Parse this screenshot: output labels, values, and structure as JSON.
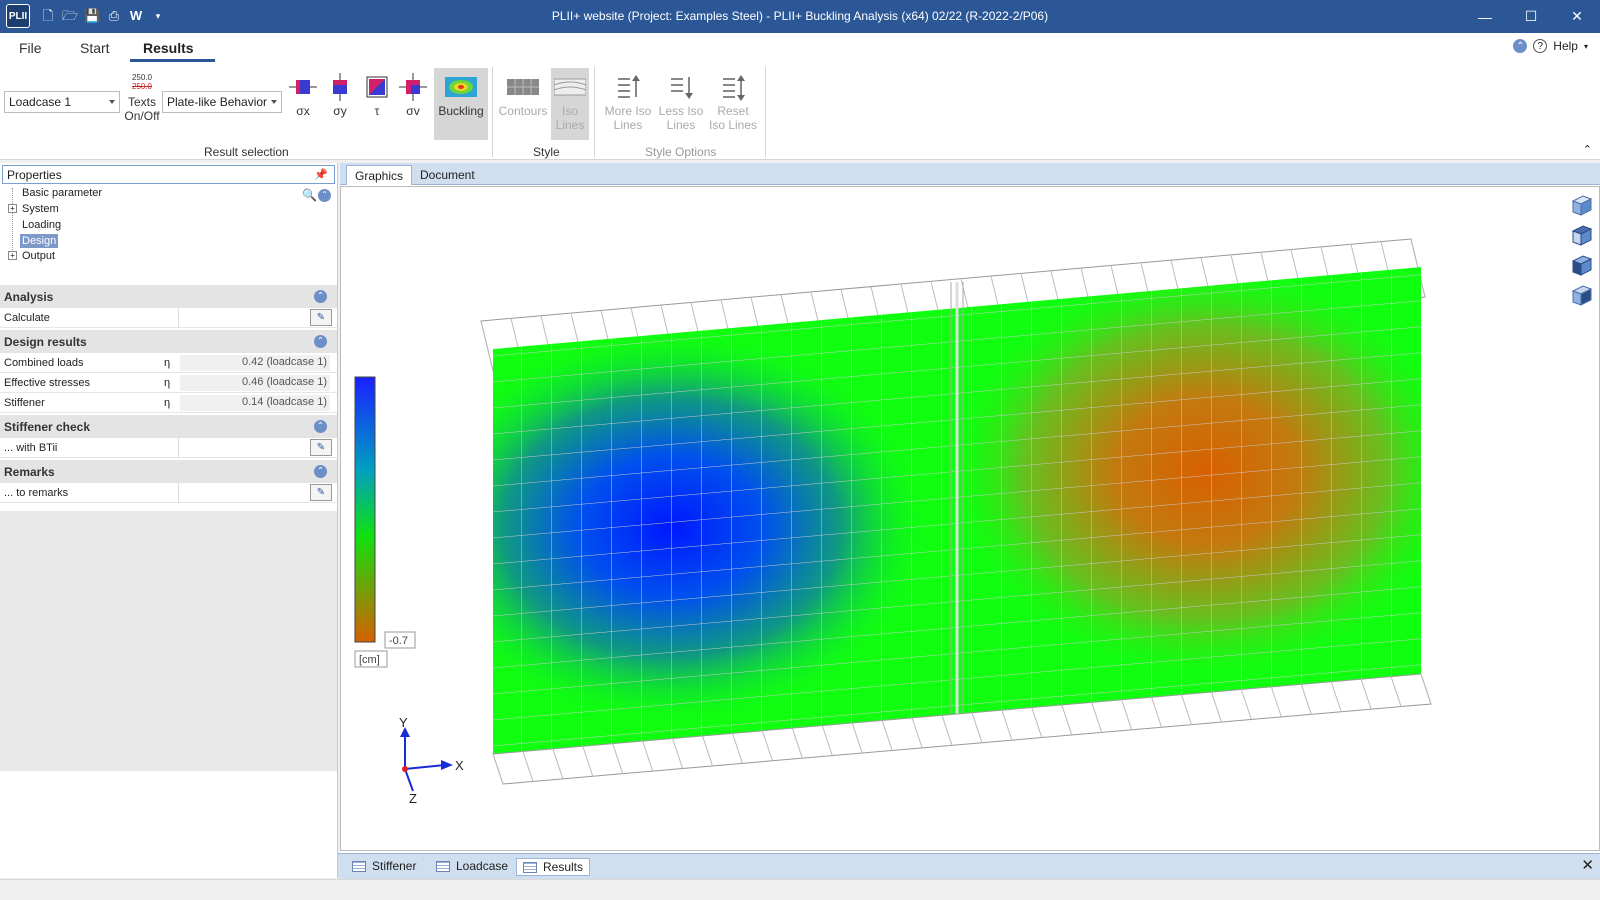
{
  "titlebar": {
    "app_icon": "PLII",
    "title": "PLII+ website (Project: Examples Steel) - PLII+ Buckling Analysis (x64) 02/22 (R-2022-2/P06)",
    "qat_word_label": "W"
  },
  "menu": {
    "file": "File",
    "start": "Start",
    "results": "Results",
    "help": "Help"
  },
  "ribbon": {
    "loadcase": "Loadcase 1",
    "texts_icon_top": "250.0",
    "texts_icon_bottom": "250.0",
    "texts_line1": "Texts",
    "texts_line2": "On/Off",
    "behaviour": "Plate-like Behavior",
    "sx": "σx",
    "sy": "σy",
    "tau": "τ",
    "sv": "σv",
    "buckling": "Buckling",
    "contours": "Contours",
    "iso1": "Iso",
    "iso2": "Lines",
    "more1": "More Iso",
    "more2": "Lines",
    "less1": "Less Iso",
    "less2": "Lines",
    "reset1": "Reset",
    "reset2": "Iso Lines",
    "group_result": "Result selection",
    "group_style": "Style",
    "group_style_options": "Style Options"
  },
  "properties": {
    "header": "Properties",
    "tree": [
      "Basic parameter",
      "System",
      "Loading",
      "Design",
      "Output"
    ],
    "selected": "Design"
  },
  "analysis": {
    "header": "Analysis",
    "calculate": "Calculate"
  },
  "design_results": {
    "header": "Design results",
    "eta": "η",
    "rows": [
      {
        "label": "Combined loads",
        "value": "0.42 (loadcase 1)"
      },
      {
        "label": "Effective stresses",
        "value": "0.46 (loadcase 1)"
      },
      {
        "label": "Stiffener",
        "value": "0.14 (loadcase 1)"
      }
    ]
  },
  "stiffener_check": {
    "header": "Stiffener check",
    "row": "... with BTii"
  },
  "remarks": {
    "header": "Remarks",
    "row": "... to remarks"
  },
  "graphics": {
    "tab_graphics": "Graphics",
    "tab_document": "Document",
    "legend_value": "-0.7",
    "legend_unit": "[cm]",
    "axis_x": "X",
    "axis_y": "Y",
    "axis_z": "Z",
    "colors": {
      "low": "#0033ff",
      "mid": "#00ff00",
      "high": "#d46a00"
    }
  },
  "bottom_tabs": [
    "Stiffener",
    "Loadcase",
    "Results"
  ],
  "bottom_active": "Results"
}
